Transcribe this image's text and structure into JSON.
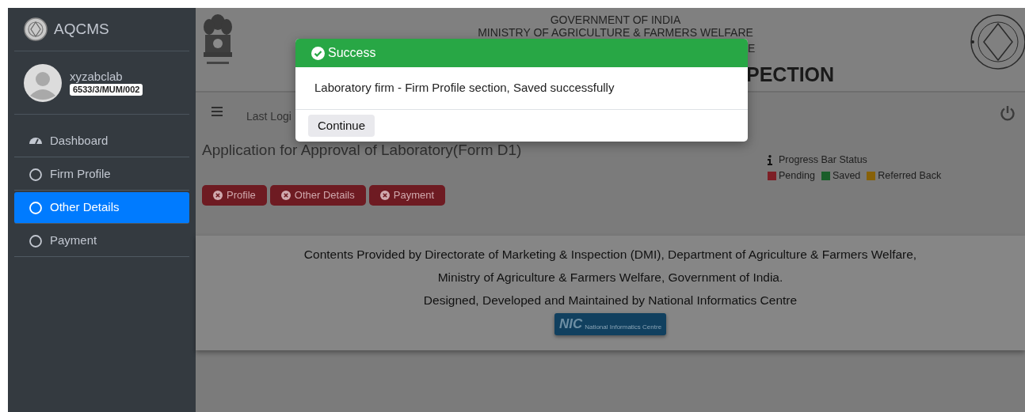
{
  "sidebar": {
    "brand": "AQCMS",
    "user": {
      "name": "xyzabclab",
      "code": "6533/3/MUM/002"
    },
    "items": [
      {
        "kind": "dashboard",
        "label": "Dashboard",
        "selected": false
      },
      {
        "kind": "step",
        "label": "Firm Profile",
        "selected": false
      },
      {
        "kind": "step",
        "label": "Other Details",
        "selected": true
      },
      {
        "kind": "step",
        "label": "Payment",
        "selected": false
      }
    ]
  },
  "header": {
    "lines": [
      "GOVERNMENT OF INDIA",
      "MINISTRY OF AGRICULTURE & FARMERS WELFARE",
      "E"
    ],
    "title": "PECTION"
  },
  "toolbar": {
    "last_login": "Last Logi"
  },
  "page_title": "Application for Approval of Laboratory(Form D1)",
  "legend": {
    "title": "Progress Bar Status",
    "items": [
      {
        "label": "Pending",
        "color": "#7d1f26"
      },
      {
        "label": "Saved",
        "color": "#1a5e2a"
      },
      {
        "label": "Referred Back",
        "color": "#876109"
      }
    ]
  },
  "steps": [
    {
      "label": "Profile",
      "color": "#6e1b22"
    },
    {
      "label": "Other Details",
      "color": "#6e1b22"
    },
    {
      "label": "Payment",
      "color": "#6e1b22"
    }
  ],
  "footer": {
    "lines": [
      "Contents Provided by Directorate of Marketing & Inspection (DMI), Department of Agriculture & Farmers Welfare,",
      "Ministry of Agriculture & Farmers Welfare, Government of India.",
      "Designed, Developed and Maintained by National Informatics Centre"
    ],
    "logo": {
      "mark": "NIC",
      "name": "National Informatics Centre"
    }
  },
  "modal": {
    "title": "Success",
    "message": "Laboratory firm - Firm Profile section, Saved successfully",
    "button": "Continue"
  }
}
